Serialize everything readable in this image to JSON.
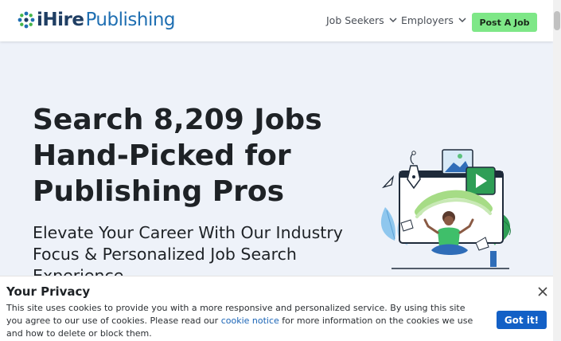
{
  "header": {
    "logo_brand": "iHire",
    "logo_sector": "Publishing",
    "nav": [
      {
        "label": "Job Seekers"
      },
      {
        "label": "Employers"
      }
    ],
    "post_job_label": "Post A Job"
  },
  "hero": {
    "title_line1": "Search 8,209 Jobs",
    "title_line2": "Hand-Picked for",
    "title_line3": "Publishing Pros",
    "subtitle_line1": "Elevate Your Career With Our Industry",
    "subtitle_line2": "Focus & Personalized Job Search",
    "subtitle_line3": "Experience"
  },
  "cookie_banner": {
    "title": "Your Privacy",
    "text_part1": "This site uses cookies to provide you with a more responsive and personalized service. By using this site you agree to our use of cookies. Please read our ",
    "link_text": "cookie notice",
    "text_part2": " for more information on the cookies we use and how to delete or block them.",
    "button_label": "Got it!"
  },
  "colors": {
    "brand_navy": "#1f3e63",
    "brand_blue": "#1f6fb2",
    "post_job_green": "#7ee787",
    "hero_bg": "#eef2f9",
    "cookie_button": "#1360c6"
  },
  "icons": [
    "ihire-logo-icon",
    "chevron-down-icon",
    "close-icon",
    "hero-illustration"
  ]
}
